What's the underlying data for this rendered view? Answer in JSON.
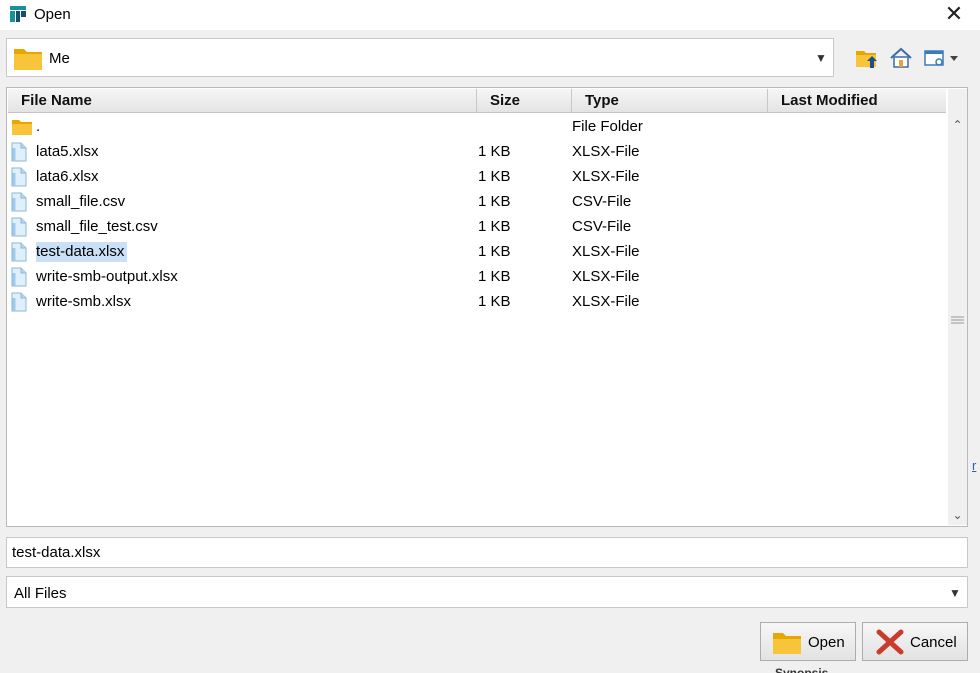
{
  "window": {
    "title": "Open",
    "close_glyph": "✕"
  },
  "location": {
    "current": "Me",
    "dropdown_glyph": "▼"
  },
  "toolbar": {
    "icons": [
      "folder-up-icon",
      "home-icon",
      "view-options-icon"
    ]
  },
  "columns": {
    "name": "File Name",
    "size": "Size",
    "type": "Type",
    "modified": "Last Modified"
  },
  "files": [
    {
      "name": ".",
      "size": "",
      "type": "File Folder",
      "kind": "folder",
      "selected": false
    },
    {
      "name": "lata5.xlsx",
      "size": "1 KB",
      "type": "XLSX-File",
      "kind": "file",
      "selected": false
    },
    {
      "name": "lata6.xlsx",
      "size": "1 KB",
      "type": "XLSX-File",
      "kind": "file",
      "selected": false
    },
    {
      "name": "small_file.csv",
      "size": "1 KB",
      "type": "CSV-File",
      "kind": "file",
      "selected": false
    },
    {
      "name": "small_file_test.csv",
      "size": "1 KB",
      "type": "CSV-File",
      "kind": "file",
      "selected": false
    },
    {
      "name": "test-data.xlsx",
      "size": "1 KB",
      "type": "XLSX-File",
      "kind": "file",
      "selected": true
    },
    {
      "name": "write-smb-output.xlsx",
      "size": "1 KB",
      "type": "XLSX-File",
      "kind": "file",
      "selected": false
    },
    {
      "name": "write-smb.xlsx",
      "size": "1 KB",
      "type": "XLSX-File",
      "kind": "file",
      "selected": false
    }
  ],
  "filename_field": {
    "value": "test-data.xlsx"
  },
  "filter": {
    "selected": "All Files",
    "dropdown_glyph": "▼"
  },
  "buttons": {
    "open": "Open",
    "cancel": "Cancel"
  },
  "colors": {
    "selection": "#c9e0f7",
    "folder": "#f4b400",
    "cancel_x": "#c83b2d"
  },
  "background_fragments": {
    "right_link": "r",
    "bottom_text": "Synopsis"
  }
}
